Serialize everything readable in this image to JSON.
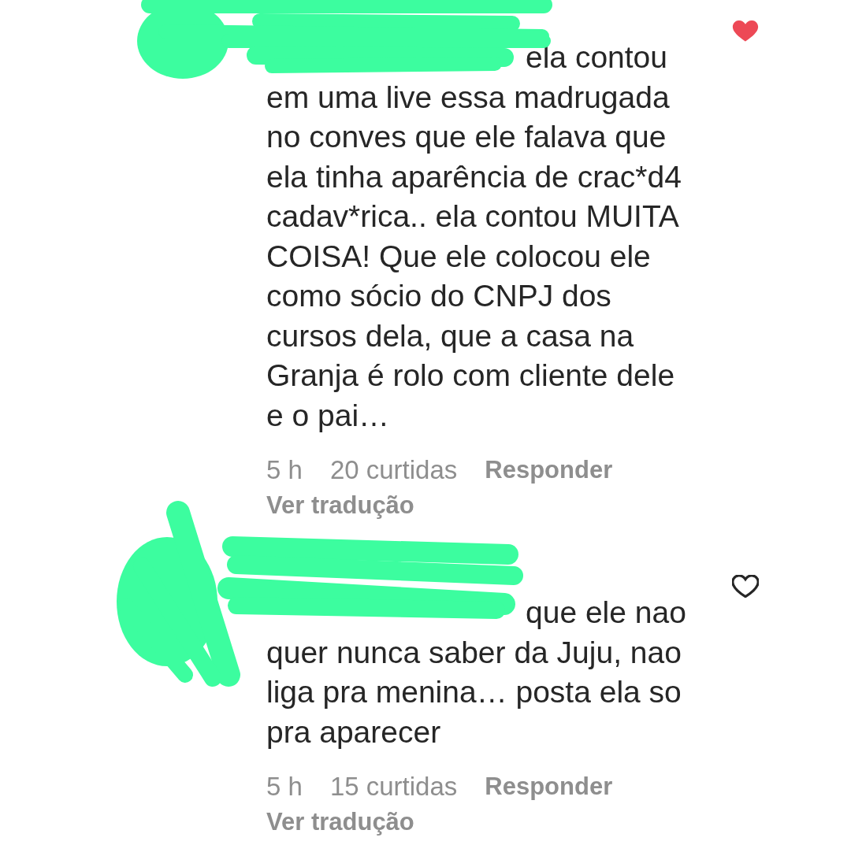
{
  "comments": [
    {
      "author_redacted": true,
      "liked": true,
      "text": "ela contou em uma live essa madrugada no conves que ele falava que ela tinha aparência de crac*d4 cadav*rica.. ela contou MUITA COISA! Que ele colocou ele como sócio do CNPJ dos cursos dela, que a casa na Granja é rolo com cliente dele e o pai…",
      "time": "5 h",
      "likes": "20 curtidas",
      "reply": "Responder",
      "translate": "Ver tradução"
    },
    {
      "author_redacted": true,
      "liked": false,
      "text": "que ele nao quer nunca saber da Juju, nao liga pra menina… posta ela so pra aparecer",
      "time": "5 h",
      "likes": "15 curtidas",
      "reply": "Responder",
      "translate": "Ver tradução"
    }
  ]
}
